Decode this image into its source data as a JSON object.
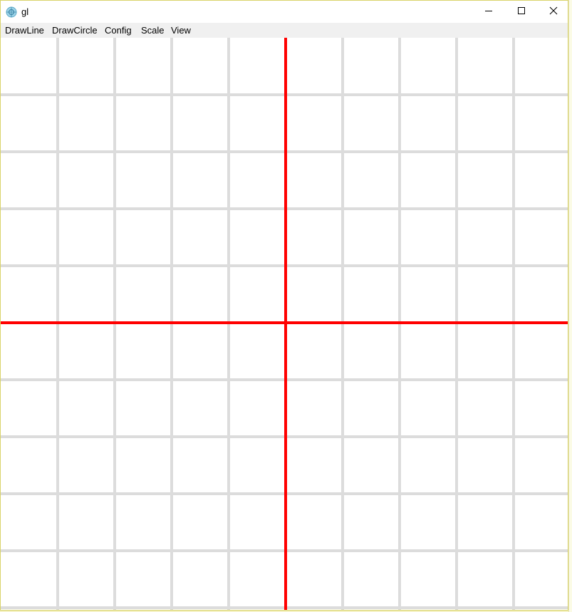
{
  "window": {
    "title": "gl",
    "controls": {
      "minimize": "minimize-icon",
      "maximize": "maximize-icon",
      "close": "close-icon"
    }
  },
  "menu": {
    "items": [
      {
        "label": "DrawLine"
      },
      {
        "label": "DrawCircle"
      },
      {
        "label": "Config"
      },
      {
        "label": "Scale"
      },
      {
        "label": "View"
      }
    ]
  },
  "canvas": {
    "background_color": "#ffffff",
    "grid_color": "#dcdcdc",
    "axis_color": "#ff0000"
  }
}
